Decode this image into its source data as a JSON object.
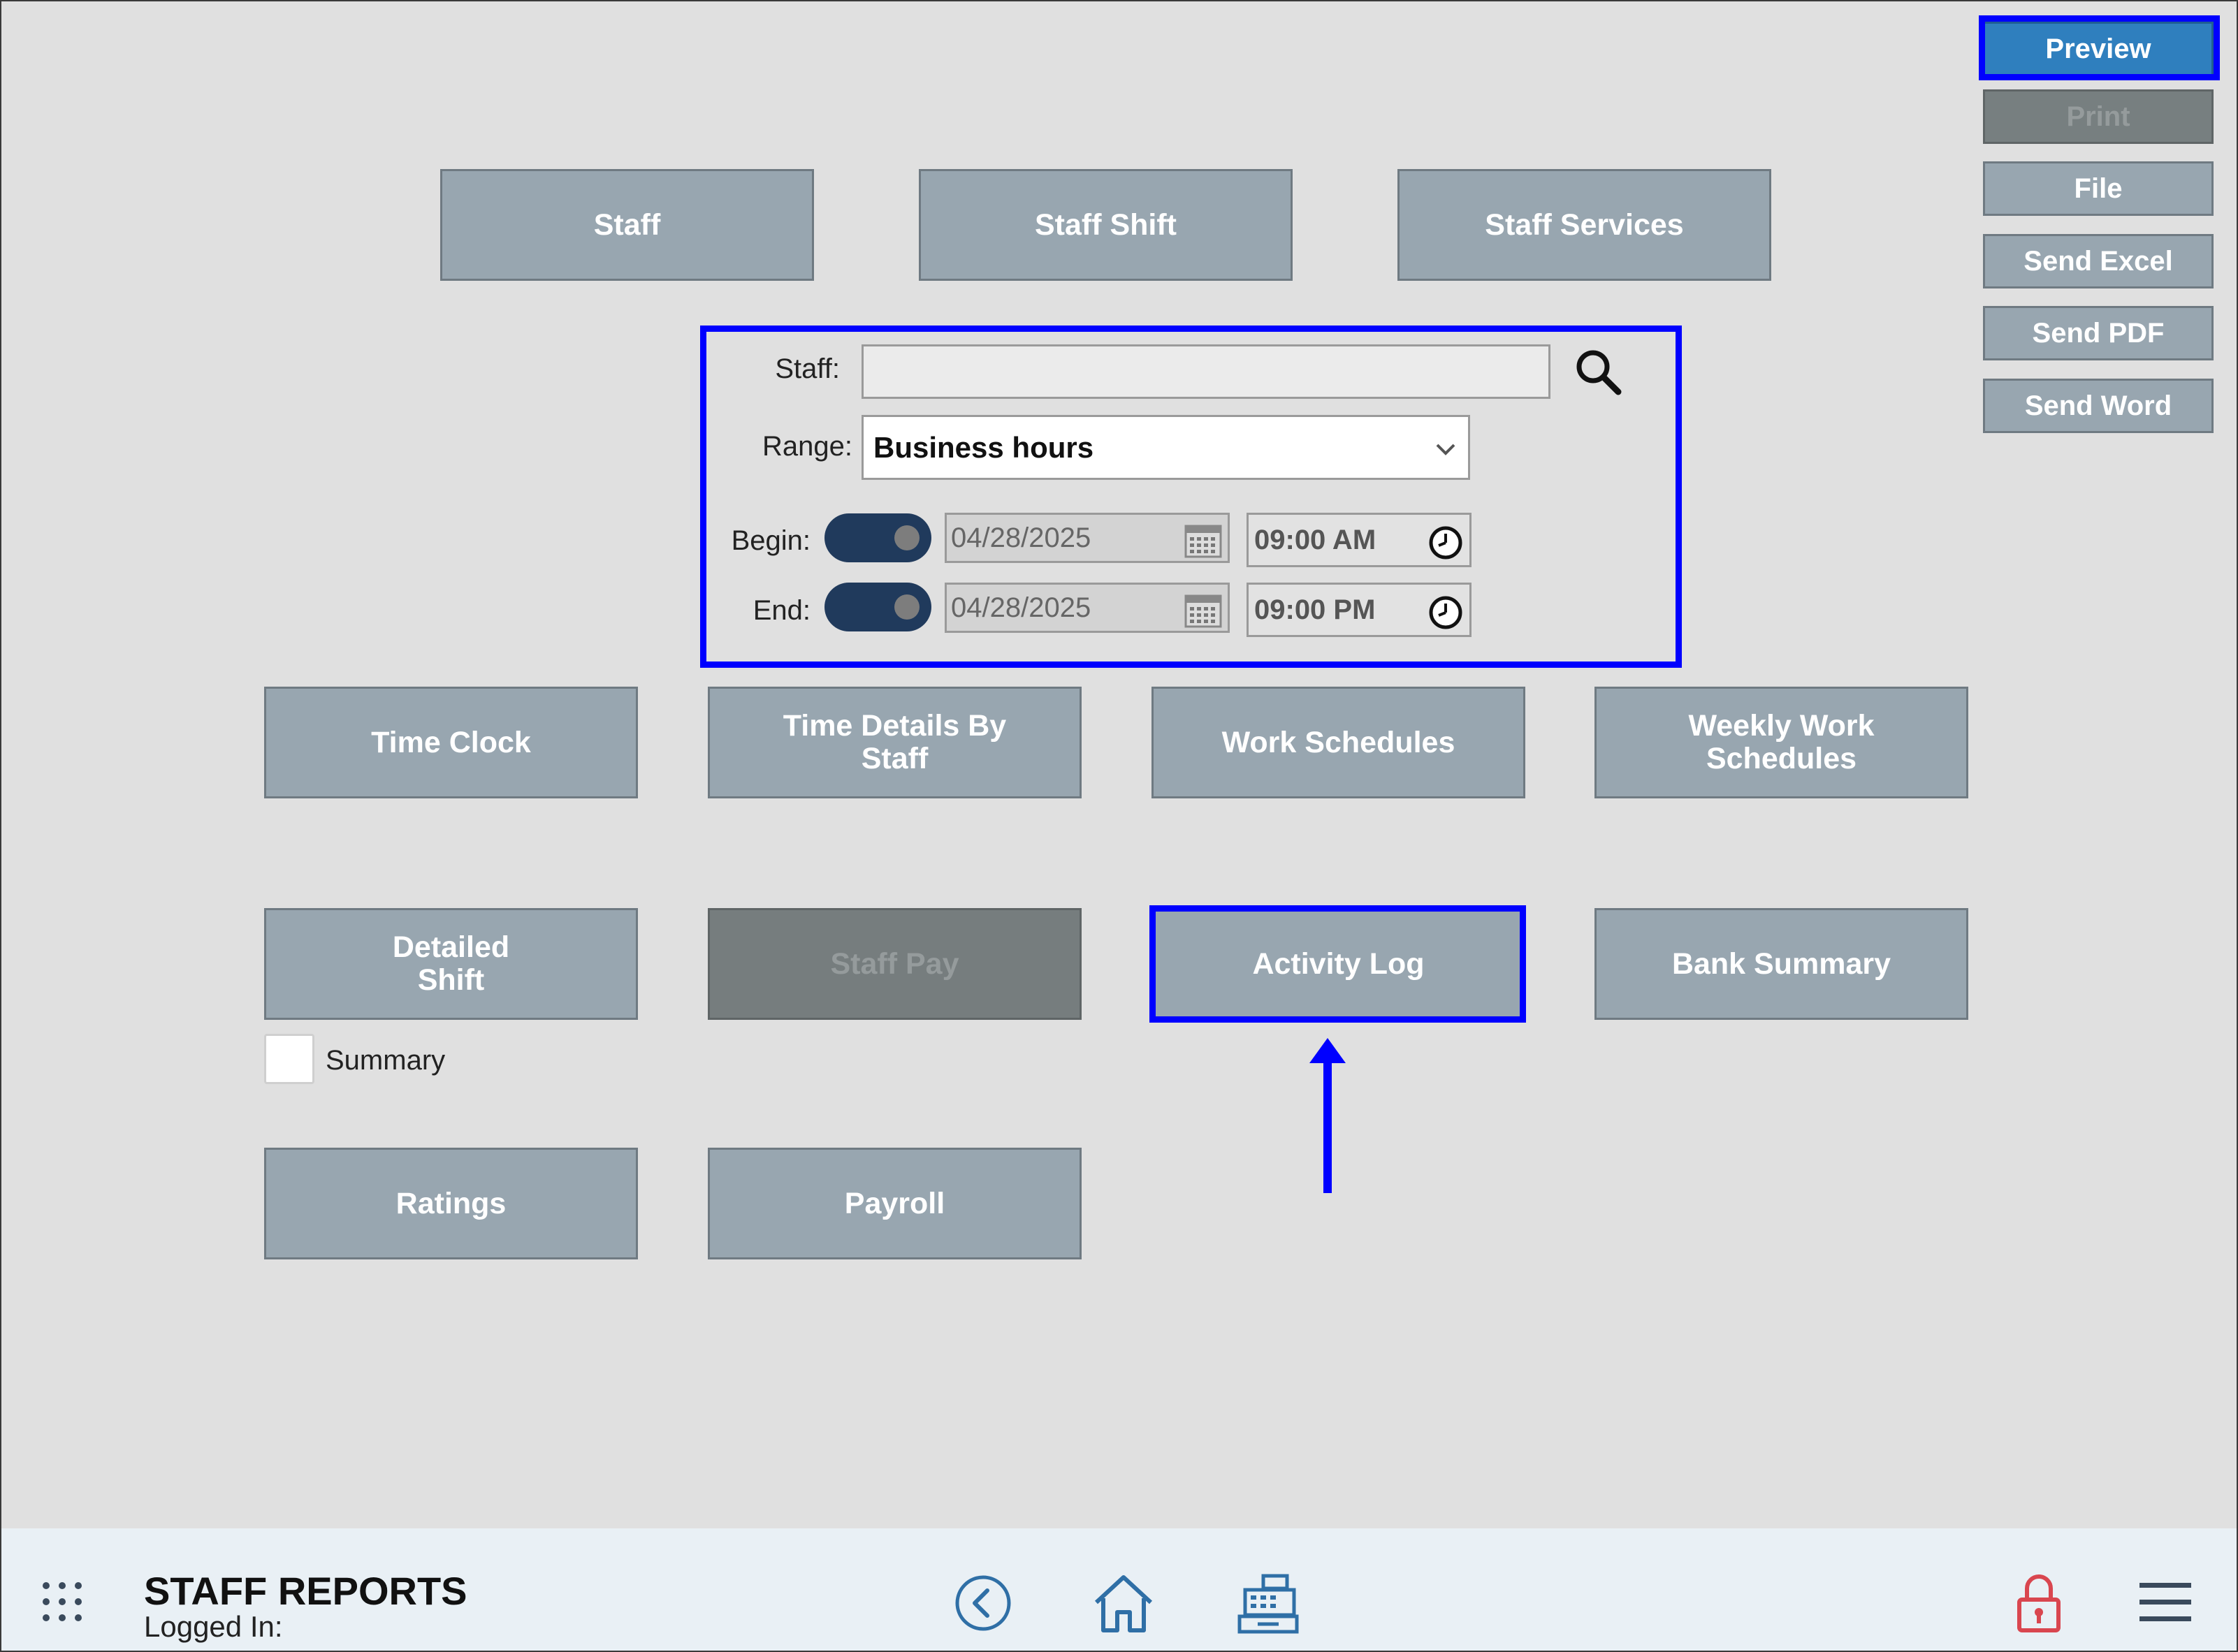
{
  "sidebar_actions": {
    "preview": "Preview",
    "print": "Print",
    "file": "File",
    "send_excel": "Send Excel",
    "send_pdf": "Send PDF",
    "send_word": "Send Word"
  },
  "top_reports": {
    "staff": "Staff",
    "staff_shift": "Staff Shift",
    "staff_services": "Staff Services"
  },
  "filters": {
    "staff_label": "Staff:",
    "staff_value": "",
    "range_label": "Range:",
    "range_value": "Business hours",
    "begin_label": "Begin:",
    "begin_date": "04/28/2025",
    "begin_time": "09:00 AM",
    "end_label": "End:",
    "end_date": "04/28/2025",
    "end_time": "09:00 PM"
  },
  "reports": {
    "time_clock": "Time Clock",
    "time_details_by_staff": "Time Details By\nStaff",
    "work_schedules": "Work Schedules",
    "weekly_work_schedules": "Weekly Work\nSchedules",
    "detailed_shift": "Detailed\nShift",
    "summary_label": "Summary",
    "staff_pay": "Staff Pay",
    "activity_log": "Activity Log",
    "bank_summary": "Bank Summary",
    "ratings": "Ratings",
    "payroll": "Payroll"
  },
  "footer": {
    "title": "STAFF REPORTS",
    "logged_in": "Logged In:"
  },
  "colors": {
    "accent_highlight": "#0000ff",
    "primary_button": "#2f7fbe",
    "report_button": "#98a6b0",
    "disabled_button": "#767d7e"
  }
}
